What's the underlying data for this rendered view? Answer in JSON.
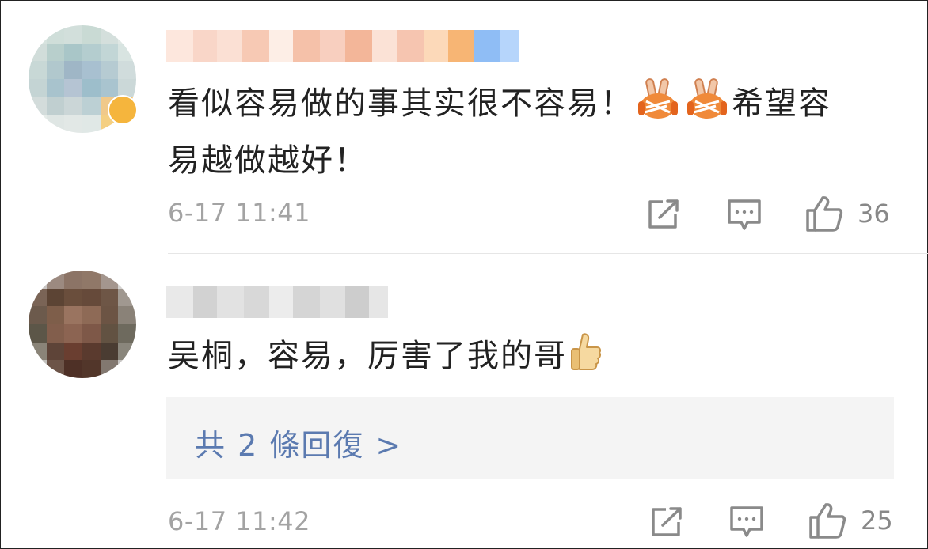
{
  "comments": [
    {
      "text_main": "看似容易做的事其实很不容易！",
      "text_after_emoji": "希望容",
      "text_line2": "易越做越好！",
      "emoji": [
        "victory-hand-emoji",
        "victory-hand-emoji"
      ],
      "time": "6-17 11:41",
      "likes": "36"
    },
    {
      "text": "吴桐，容易，厉害了我的哥",
      "emoji": [
        "thumbs-up-emoji"
      ],
      "replies_label": "共 2 條回復 >",
      "time": "6-17 11:42",
      "likes": "25"
    }
  ],
  "colors": {
    "time": "#a3a3a3",
    "link": "#5b7ab0",
    "reply_box_bg": "#f4f4f4",
    "icon": "#8a8a8a"
  },
  "icons": [
    "share-icon",
    "comment-icon",
    "like-icon"
  ]
}
